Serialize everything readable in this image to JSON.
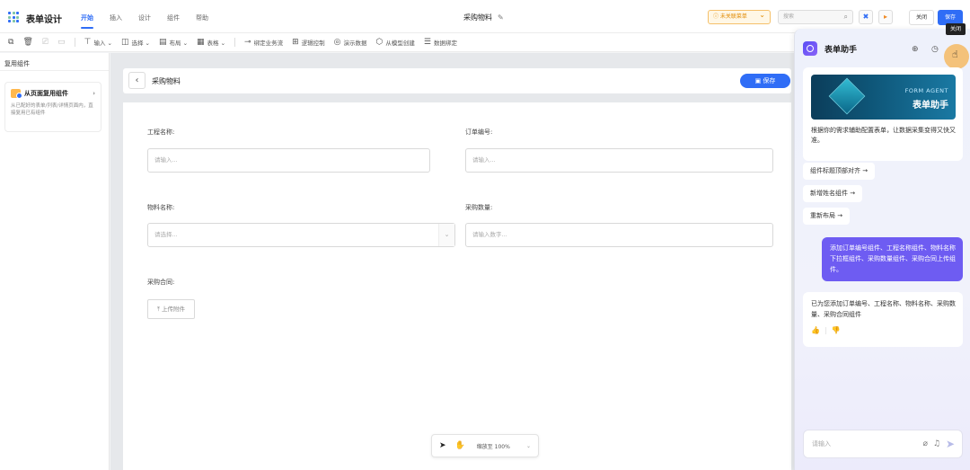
{
  "app": {
    "title": "表单设计"
  },
  "nav": {
    "tabs": [
      {
        "label": "开始",
        "active": true
      },
      {
        "label": "插入"
      },
      {
        "label": "设计"
      },
      {
        "label": "组件"
      },
      {
        "label": "帮助"
      }
    ]
  },
  "doc": {
    "title": "采购物料"
  },
  "header_right": {
    "warning": "未关联菜单",
    "search_placeholder": "搜索",
    "close_label": "关闭",
    "save_label": "保存"
  },
  "toolbar": {
    "items": [
      {
        "icon": "copy-icon",
        "label": ""
      },
      {
        "icon": "trash-icon",
        "label": ""
      },
      {
        "icon": "brush-icon",
        "label": ""
      },
      {
        "icon": "paste-icon",
        "label": ""
      },
      {
        "icon": "input-icon",
        "label": "输入 ⌄"
      },
      {
        "icon": "select-icon",
        "label": "选择 ⌄"
      },
      {
        "icon": "layout-icon",
        "label": "布局 ⌄"
      },
      {
        "icon": "table-icon",
        "label": "表格 ⌄"
      },
      {
        "icon": "bind-icon",
        "label": "绑定业务流"
      },
      {
        "icon": "logic-icon",
        "label": "逻辑控制"
      },
      {
        "icon": "demo-icon",
        "label": "演示数据"
      },
      {
        "icon": "model-icon",
        "label": "从模型创建"
      },
      {
        "icon": "database-icon",
        "label": "数据绑定"
      }
    ]
  },
  "left_panel": {
    "title": "复用组件",
    "card_title": "从页面复用组件",
    "card_desc": "从已配好的表单/列表/详情页面内，直接复用已有组件"
  },
  "form": {
    "title": "采购物料",
    "save_label": "保存",
    "fields": {
      "project_name": {
        "label": "工程名称:",
        "placeholder": "请输入..."
      },
      "order_no": {
        "label": "订单编号:",
        "placeholder": "请输入..."
      },
      "material_name": {
        "label": "物料名称:",
        "placeholder": "请选择..."
      },
      "purchase_qty": {
        "label": "采购数量:",
        "placeholder": "请输入数字..."
      },
      "contract": {
        "label": "采购合同:",
        "button": "上传附件"
      }
    }
  },
  "zoom": {
    "label": "缩放至 100%"
  },
  "assistant": {
    "title": "表单助手",
    "tooltip": "关闭",
    "banner_en": "FORM AGENT",
    "banner_cn": "表单助手",
    "intro": "根据你的需求辅助配置表单，让数据采集变得又快又准。",
    "suggestions": [
      "组件标题顶部对齐 →",
      "新增姓名组件 →",
      "重新布局 →"
    ],
    "user_message": "添加订单编号组件、工程名称组件、物料名称下拉框组件、采购数量组件、采购合同上传组件。",
    "bot_message": "已为您添加订单编号、工程名称、物料名称、采购数量、采购合同组件",
    "input_placeholder": "请输入"
  },
  "colors": {
    "primary": "#2f6df6",
    "assistant_accent": "#6e5cf2",
    "warning": "#e08a00"
  }
}
